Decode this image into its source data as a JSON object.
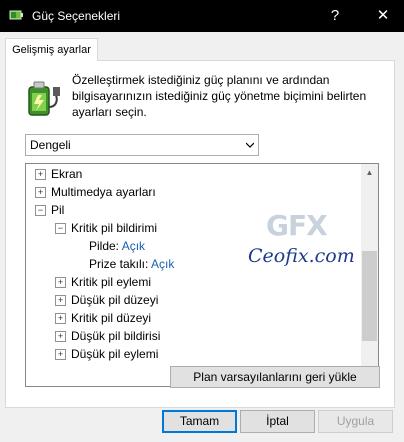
{
  "window": {
    "title": "Güç Seçenekleri",
    "help": "?",
    "close": "✕"
  },
  "tab": {
    "label": "Gelişmiş ayarlar"
  },
  "description": "Özelleştirmek istediğiniz güç planını ve ardından bilgisayarınızın istediğiniz güç yönetme biçimini belirten ayarları seçin.",
  "plan_select": {
    "value": "Dengeli"
  },
  "tree": {
    "items": [
      {
        "label": "Ekran",
        "expander": "+"
      },
      {
        "label": "Multimedya ayarları",
        "expander": "+"
      },
      {
        "label": "Pil",
        "expander": "−"
      },
      {
        "label": "Kritik pil bildirimi",
        "expander": "−"
      },
      {
        "label": "Pilde:",
        "value": "Açık"
      },
      {
        "label": "Prize takılı:",
        "value": "Açık"
      },
      {
        "label": "Kritik pil eylemi",
        "expander": "+"
      },
      {
        "label": "Düşük pil düzeyi",
        "expander": "+"
      },
      {
        "label": "Kritik pil düzeyi",
        "expander": "+"
      },
      {
        "label": "Düşük pil bildirisi",
        "expander": "+"
      },
      {
        "label": "Düşük pil eylemi",
        "expander": "+"
      }
    ]
  },
  "watermark": {
    "brand": "GFX",
    "site": "Ceofix.com"
  },
  "buttons": {
    "restore": "Plan varsayılanlarını geri yükle",
    "ok": "Tamam",
    "cancel": "İptal",
    "apply": "Uygula"
  },
  "colors": {
    "titlebar": "#000000",
    "link": "#1a5fb4",
    "watermark": "#1f3a8c"
  },
  "icons": {
    "app": "power-options-icon",
    "battery": "battery-plug-icon"
  }
}
